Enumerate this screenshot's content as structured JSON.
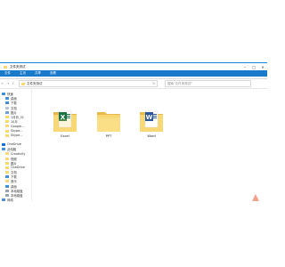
{
  "window": {
    "title": "文件夹测试"
  },
  "window_controls": {
    "minimize": "–",
    "maximize": "□",
    "close": "✕"
  },
  "ribbon": {
    "tabs": [
      "文件",
      "主页",
      "共享",
      "查看"
    ]
  },
  "nav": {
    "back": "←",
    "forward": "→",
    "up": "↑",
    "refresh": "↻"
  },
  "address": {
    "path": "文件夹测试",
    "search_placeholder": "搜索\"文件夹测试\""
  },
  "sidebar": {
    "quick_access": "快速",
    "items": [
      "桌面",
      "下载",
      "文档",
      "图片",
      "1月份_01",
      "10月",
      "Google...",
      "Skype...",
      "Skype..."
    ],
    "onedrive": "OneDrive",
    "pc": "此电脑",
    "pc_items": [
      "Creativity",
      "视频",
      "图片",
      "OneDrive",
      "文档",
      "下载",
      "音乐",
      "桌面"
    ],
    "drives": [
      "本地磁盘",
      "本地磁盘"
    ],
    "network": "网络"
  },
  "files": [
    {
      "name": "Excel",
      "badge": "X",
      "badge_color": "#1e7145"
    },
    {
      "name": "PPT",
      "badge": "",
      "badge_color": ""
    },
    {
      "name": "Word",
      "badge": "W",
      "badge_color": "#2b579a"
    }
  ],
  "colors": {
    "accent": "#1979ca",
    "folder": "#f8d775",
    "folder_dark": "#e8b84a"
  }
}
